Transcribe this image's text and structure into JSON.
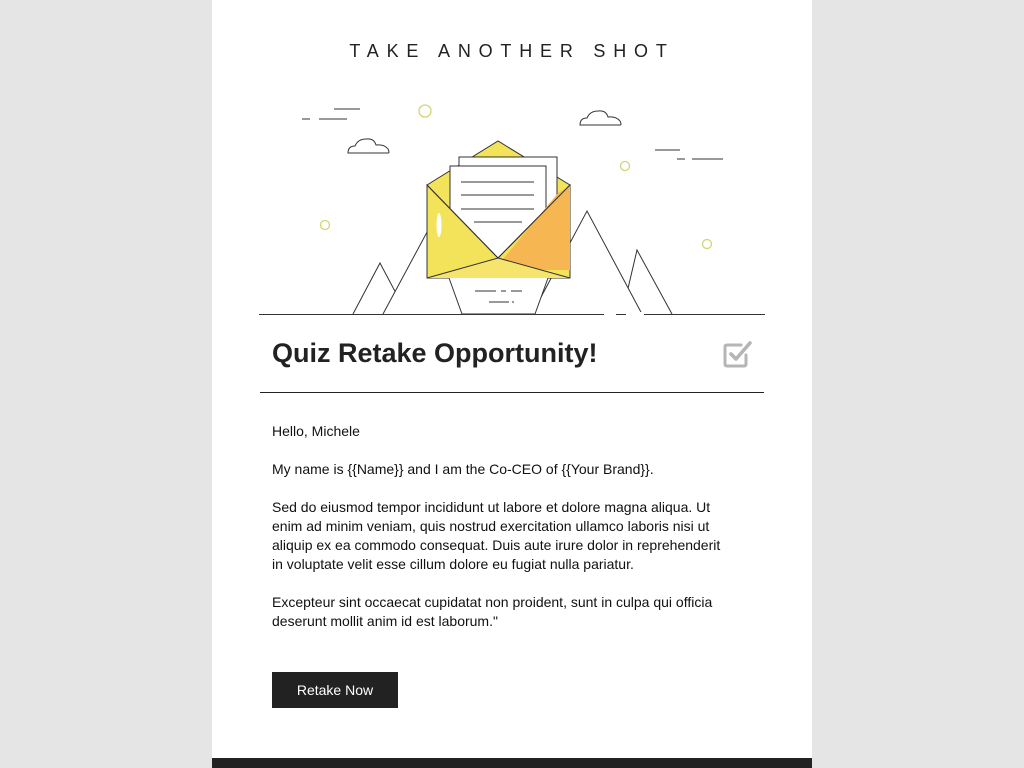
{
  "header": {
    "kicker": "TAKE ANOTHER SHOT"
  },
  "illustration": {
    "icon": "open-envelope-with-letter",
    "colors": {
      "envelope": "#f2e35a",
      "shadow": "#f6b752",
      "dots": "#d8dd7a",
      "line": "#333333"
    }
  },
  "heading": {
    "title": "Quiz Retake Opportunity!",
    "icon": "checked-box-icon"
  },
  "message": {
    "greeting": "Hello, Michele",
    "intro": "My name is {{Name}} and I am the Co-CEO of {{Your Brand}}.",
    "paragraph1": "Sed do eiusmod tempor incididunt ut labore et dolore magna aliqua. Ut enim ad minim veniam, quis nostrud exercitation ullamco laboris nisi ut aliquip ex ea commodo consequat. Duis aute irure dolor in reprehenderit in voluptate velit esse cillum dolore eu fugiat nulla pariatur.",
    "paragraph2": "Excepteur sint occaecat cupidatat non proident, sunt in culpa qui officia deserunt mollit anim id est laborum.\""
  },
  "cta": {
    "label": "Retake Now"
  },
  "theme": {
    "background": "#e5e5e5",
    "card": "#ffffff",
    "dark": "#222222"
  }
}
